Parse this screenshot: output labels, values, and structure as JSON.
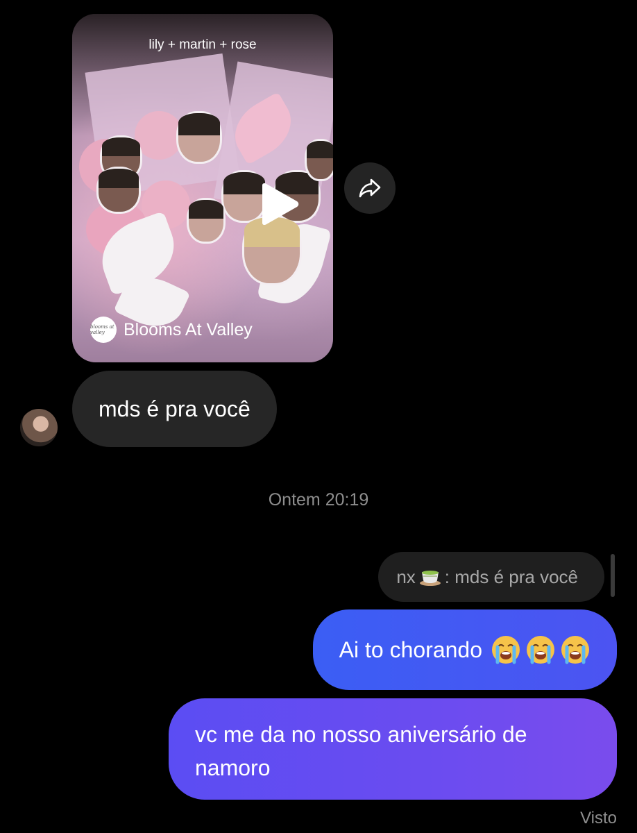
{
  "shared_post": {
    "title": "lily + martin + rose",
    "brand_logo_text": "blooms at valley",
    "brand_name": "Blooms At Valley"
  },
  "messages": {
    "incoming_text": "mds é pra você",
    "timestamp": "Ontem 20:19",
    "reply_quote": {
      "sender": "nx",
      "text": ": mds é pra você"
    },
    "outgoing_1": "Ai to chorando",
    "outgoing_2": "vc me da no nosso aniversário de namoro",
    "status": "Visto"
  },
  "icons": {
    "play": "play-icon",
    "share": "share-arrow-icon",
    "crying_emoji": "loudly-crying-face-icon",
    "tea": "teacup-icon"
  },
  "colors": {
    "background": "#000000",
    "incoming_bubble": "#262626",
    "outgoing_start": "#3b5ef4",
    "outgoing_end": "#7a4ced",
    "meta_text": "#8e8e8e"
  }
}
